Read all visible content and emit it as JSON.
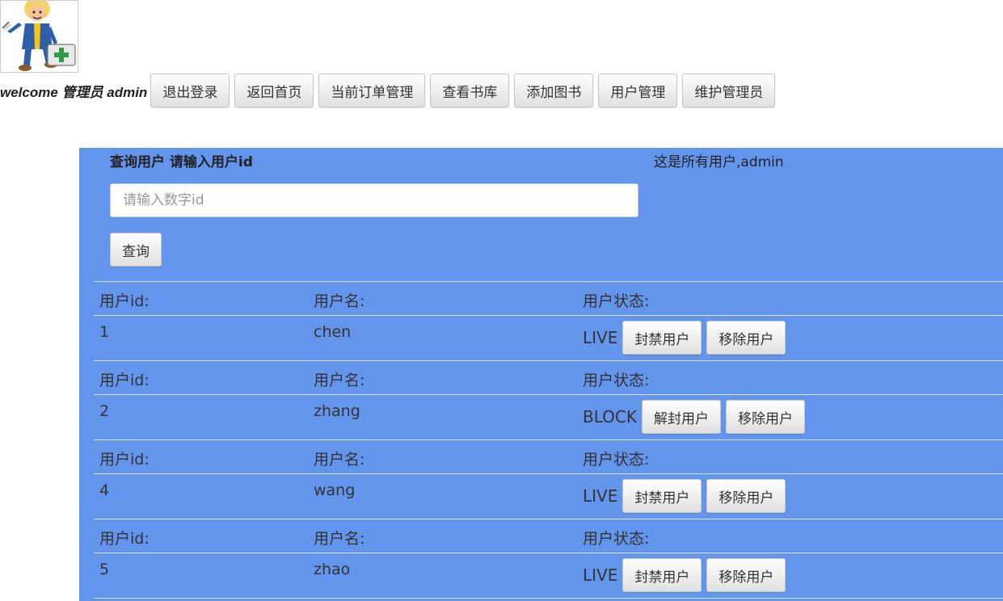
{
  "header": {
    "welcome": "welcome 管理员 admin",
    "nav": [
      "退出登录",
      "返回首页",
      "当前订单管理",
      "查看书库",
      "添加图书",
      "用户管理",
      "维护管理员"
    ]
  },
  "search": {
    "title": "查询用户 请输入用户id",
    "placeholder": "请输入数字id",
    "value": "",
    "button": "查询"
  },
  "list": {
    "title": "这是所有用户,admin",
    "headers": [
      "用户id:",
      "用户名:",
      "用户状态:"
    ],
    "users": [
      {
        "id": "1",
        "name": "chen",
        "status": "LIVE",
        "action": "封禁用户",
        "remove": "移除用户"
      },
      {
        "id": "2",
        "name": "zhang",
        "status": "BLOCK",
        "action": "解封用户",
        "remove": "移除用户"
      },
      {
        "id": "4",
        "name": "wang",
        "status": "LIVE",
        "action": "封禁用户",
        "remove": "移除用户"
      },
      {
        "id": "5",
        "name": "zhao",
        "status": "LIVE",
        "action": "封禁用户",
        "remove": "移除用户"
      }
    ]
  },
  "colors": {
    "panel": "#6495ed",
    "button_top": "#ffffff",
    "button_bottom": "#e0e0e0"
  },
  "icons": {
    "avatar": "vault-boy-with-first-aid-kit"
  }
}
